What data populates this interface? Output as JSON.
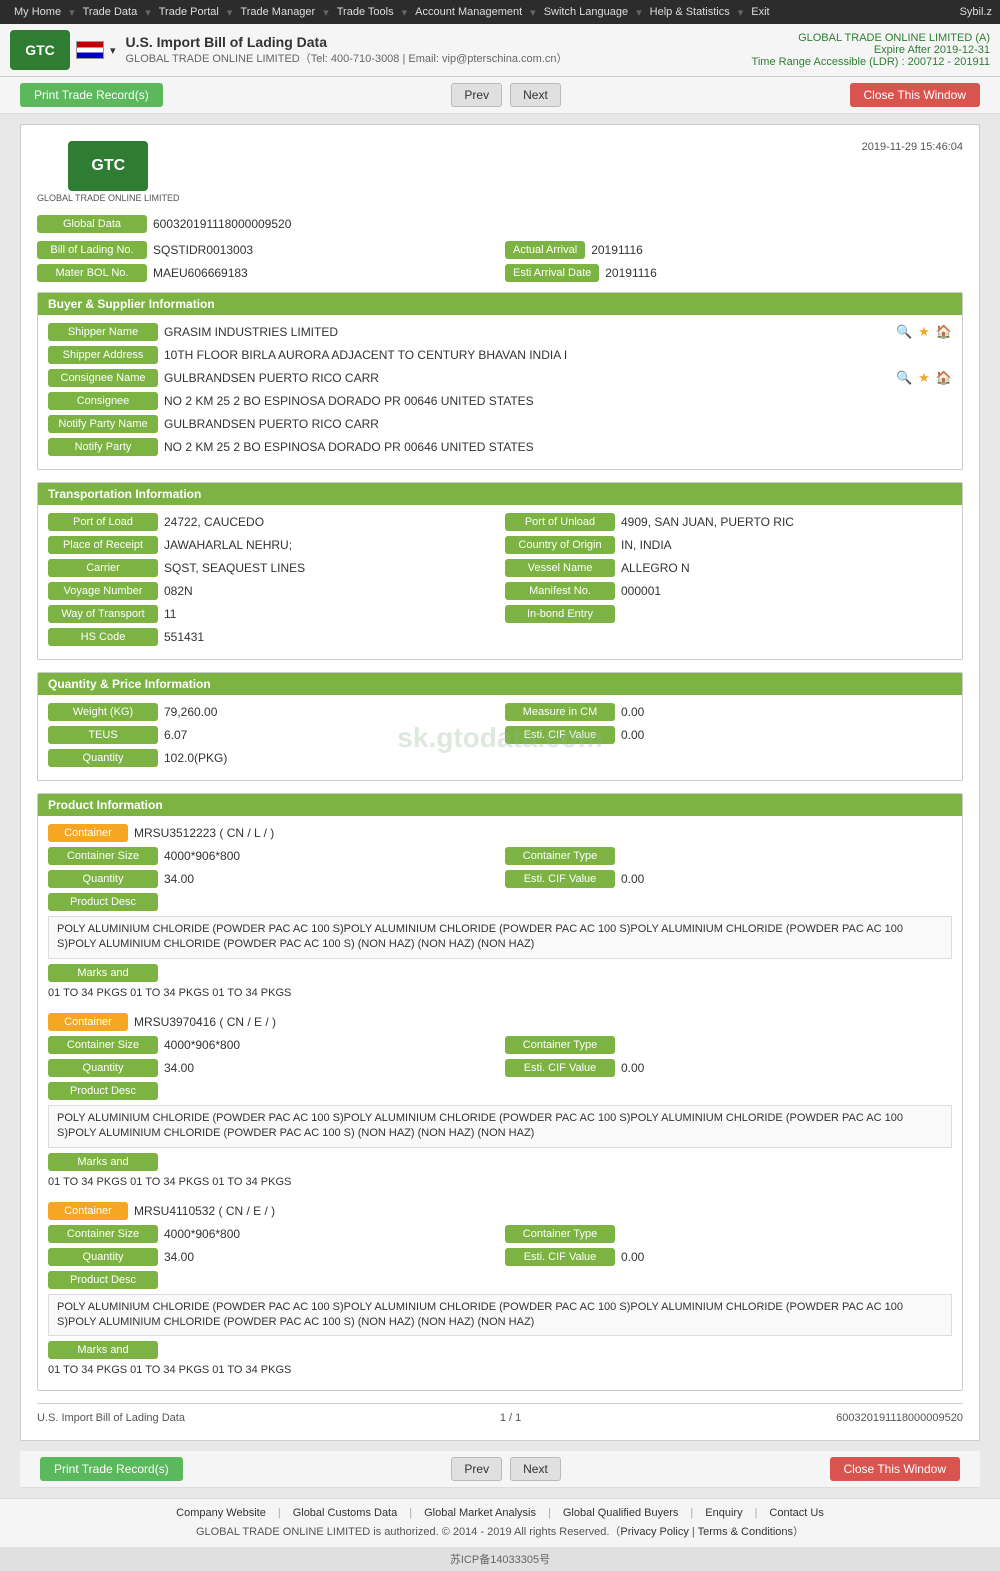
{
  "nav": {
    "items": [
      "My Home",
      "Trade Data",
      "Trade Portal",
      "Trade Manager",
      "Trade Tools",
      "Account Management",
      "Switch Language",
      "Help & Statistics",
      "Exit"
    ],
    "user": "Sybil.z"
  },
  "header": {
    "logo_text": "GTC",
    "title": "U.S. Import Bill of Lading Data",
    "subtitle": "GLOBAL TRADE ONLINE LIMITED（Tel: 400-710-3008 | Email: vip@pterschina.com.cn）",
    "right_line1": "GLOBAL TRADE ONLINE LIMITED (A)",
    "right_line2": "Expire After 2019-12-31",
    "right_line3": "Time Range Accessible (LDR) : 200712 - 201911"
  },
  "actions": {
    "print_label": "Print Trade Record(s)",
    "prev_label": "Prev",
    "next_label": "Next",
    "close_label": "Close This Window"
  },
  "doc": {
    "logo_text": "GTC",
    "timestamp": "2019-11-29 15:46:04",
    "global_data_label": "Global Data",
    "global_data_value": "600320191118000009520",
    "fields": {
      "bill_of_lading_label": "Bill of Lading No.",
      "bill_of_lading_value": "SQSTIDR0013003",
      "actual_arrival_label": "Actual Arrival",
      "actual_arrival_value": "20191116",
      "mater_bol_label": "Mater BOL No.",
      "mater_bol_value": "MAEU606669183",
      "esti_arrival_label": "Esti Arrival Date",
      "esti_arrival_value": "20191116"
    }
  },
  "buyer_supplier": {
    "section_title": "Buyer & Supplier Information",
    "shipper_name_label": "Shipper Name",
    "shipper_name_value": "GRASIM INDUSTRIES LIMITED",
    "shipper_address_label": "Shipper Address",
    "shipper_address_value": "10TH FLOOR BIRLA AURORA ADJACENT TO CENTURY BHAVAN INDIA I",
    "consignee_name_label": "Consignee Name",
    "consignee_name_value": "GULBRANDSEN PUERTO RICO CARR",
    "consignee_label": "Consignee",
    "consignee_value": "NO 2 KM 25 2 BO ESPINOSA DORADO PR 00646 UNITED STATES",
    "notify_party_name_label": "Notify Party Name",
    "notify_party_name_value": "GULBRANDSEN PUERTO RICO CARR",
    "notify_party_label": "Notify Party",
    "notify_party_value": "NO 2 KM 25 2 BO ESPINOSA DORADO PR 00646 UNITED STATES"
  },
  "transportation": {
    "section_title": "Transportation Information",
    "port_of_load_label": "Port of Load",
    "port_of_load_value": "24722, CAUCEDO",
    "port_of_unload_label": "Port of Unload",
    "port_of_unload_value": "4909, SAN JUAN, PUERTO RIC",
    "place_of_receipt_label": "Place of Receipt",
    "place_of_receipt_value": "JAWAHARLAL NEHRU;",
    "country_of_origin_label": "Country of Origin",
    "country_of_origin_value": "IN, INDIA",
    "carrier_label": "Carrier",
    "carrier_value": "SQST, SEAQUEST LINES",
    "vessel_name_label": "Vessel Name",
    "vessel_name_value": "ALLEGRO N",
    "voyage_number_label": "Voyage Number",
    "voyage_number_value": "082N",
    "manifest_no_label": "Manifest No.",
    "manifest_no_value": "000001",
    "way_of_transport_label": "Way of Transport",
    "way_of_transport_value": "11",
    "in_bond_entry_label": "In-bond Entry",
    "in_bond_entry_value": "",
    "hs_code_label": "HS Code",
    "hs_code_value": "551431"
  },
  "quantity_price": {
    "section_title": "Quantity & Price Information",
    "weight_label": "Weight (KG)",
    "weight_value": "79,260.00",
    "measure_cm_label": "Measure in CM",
    "measure_cm_value": "0.00",
    "teus_label": "TEUS",
    "teus_value": "6.07",
    "esti_cif_label": "Esti. CIF Value",
    "esti_cif_value": "0.00",
    "quantity_label": "Quantity",
    "quantity_value": "102.0(PKG)"
  },
  "watermark": "sk.gtodata.com",
  "product_info": {
    "section_title": "Product Information",
    "containers": [
      {
        "container_label": "Container",
        "container_value": "MRSU3512223 ( CN / L / )",
        "container_size_label": "Container Size",
        "container_size_value": "4000*906*800",
        "container_type_label": "Container Type",
        "container_type_value": "",
        "quantity_label": "Quantity",
        "quantity_value": "34.00",
        "esti_cif_label": "Esti. CIF Value",
        "esti_cif_value": "0.00",
        "product_desc_label": "Product Desc",
        "product_desc_value": "POLY ALUMINIUM CHLORIDE (POWDER PAC AC 100 S)POLY ALUMINIUM CHLORIDE (POWDER PAC AC 100 S)POLY ALUMINIUM CHLORIDE (POWDER PAC AC 100 S)POLY ALUMINIUM CHLORIDE (POWDER PAC AC 100 S) (NON HAZ) (NON HAZ) (NON HAZ)",
        "marks_label": "Marks and",
        "marks_value": "01 TO 34 PKGS 01 TO 34 PKGS 01 TO 34 PKGS"
      },
      {
        "container_label": "Container",
        "container_value": "MRSU3970416 ( CN / E / )",
        "container_size_label": "Container Size",
        "container_size_value": "4000*906*800",
        "container_type_label": "Container Type",
        "container_type_value": "",
        "quantity_label": "Quantity",
        "quantity_value": "34.00",
        "esti_cif_label": "Esti. CIF Value",
        "esti_cif_value": "0.00",
        "product_desc_label": "Product Desc",
        "product_desc_value": "POLY ALUMINIUM CHLORIDE (POWDER PAC AC 100 S)POLY ALUMINIUM CHLORIDE (POWDER PAC AC 100 S)POLY ALUMINIUM CHLORIDE (POWDER PAC AC 100 S)POLY ALUMINIUM CHLORIDE (POWDER PAC AC 100 S) (NON HAZ) (NON HAZ) (NON HAZ)",
        "marks_label": "Marks and",
        "marks_value": "01 TO 34 PKGS 01 TO 34 PKGS 01 TO 34 PKGS"
      },
      {
        "container_label": "Container",
        "container_value": "MRSU4110532 ( CN / E / )",
        "container_size_label": "Container Size",
        "container_size_value": "4000*906*800",
        "container_type_label": "Container Type",
        "container_type_value": "",
        "quantity_label": "Quantity",
        "quantity_value": "34.00",
        "esti_cif_label": "Esti. CIF Value",
        "esti_cif_value": "0.00",
        "product_desc_label": "Product Desc",
        "product_desc_value": "POLY ALUMINIUM CHLORIDE (POWDER PAC AC 100 S)POLY ALUMINIUM CHLORIDE (POWDER PAC AC 100 S)POLY ALUMINIUM CHLORIDE (POWDER PAC AC 100 S)POLY ALUMINIUM CHLORIDE (POWDER PAC AC 100 S) (NON HAZ) (NON HAZ) (NON HAZ)",
        "marks_label": "Marks and",
        "marks_value": "01 TO 34 PKGS 01 TO 34 PKGS 01 TO 34 PKGS"
      }
    ]
  },
  "doc_footer": {
    "left": "U.S. Import Bill of Lading Data",
    "center": "1 / 1",
    "right": "600320191118000009520"
  },
  "page_footer": {
    "links": [
      "Company Website",
      "Global Customs Data",
      "Global Market Analysis",
      "Global Qualified Buyers",
      "Enquiry",
      "Contact Us"
    ],
    "copyright": "GLOBAL TRADE ONLINE LIMITED is authorized. © 2014 - 2019 All rights Reserved.（",
    "privacy": "Privacy Policy",
    "separator": " | ",
    "terms": "Terms & Conditions",
    "end": "）"
  },
  "icp": {
    "text": "苏ICP备14033305号"
  }
}
